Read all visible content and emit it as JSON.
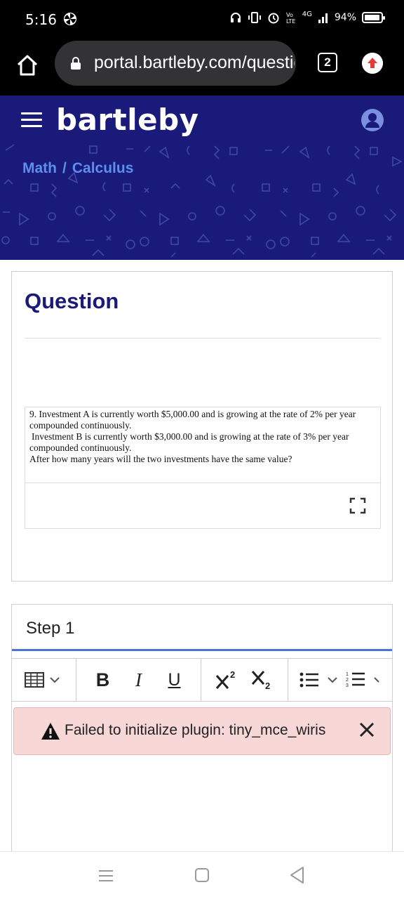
{
  "status_bar": {
    "time": "5:16",
    "network": "4G",
    "battery_percent": "94%",
    "battery_level": 0.94
  },
  "browser": {
    "url": "portal.bartleby.com/question/",
    "tab_count": "2"
  },
  "header": {
    "logo": "bartleby",
    "breadcrumb": {
      "subject": "Math",
      "separator": "/",
      "topic": "Calculus"
    }
  },
  "question": {
    "heading": "Question",
    "lines": [
      "9. Investment A is currently worth $5,000.00 and is growing at the rate of 2% per year",
      "compounded continuously.",
      " Investment B is currently worth $3,000.00 and is growing at the rate of 3% per year",
      "compounded continuously.",
      "After how many years will the two investments have the same value?"
    ]
  },
  "step": {
    "title": "Step 1",
    "toolbar": {
      "bold": "B",
      "italic": "I",
      "underline": "U"
    },
    "alert_message": "Failed to initialize plugin: tiny_mce_wiris"
  },
  "colors": {
    "header_bg": "#1a1a7a",
    "breadcrumb": "#5b8ff0",
    "step_underline": "#4a74d8",
    "alert_bg": "#f8d7d7",
    "update_icon": "#e53935"
  }
}
